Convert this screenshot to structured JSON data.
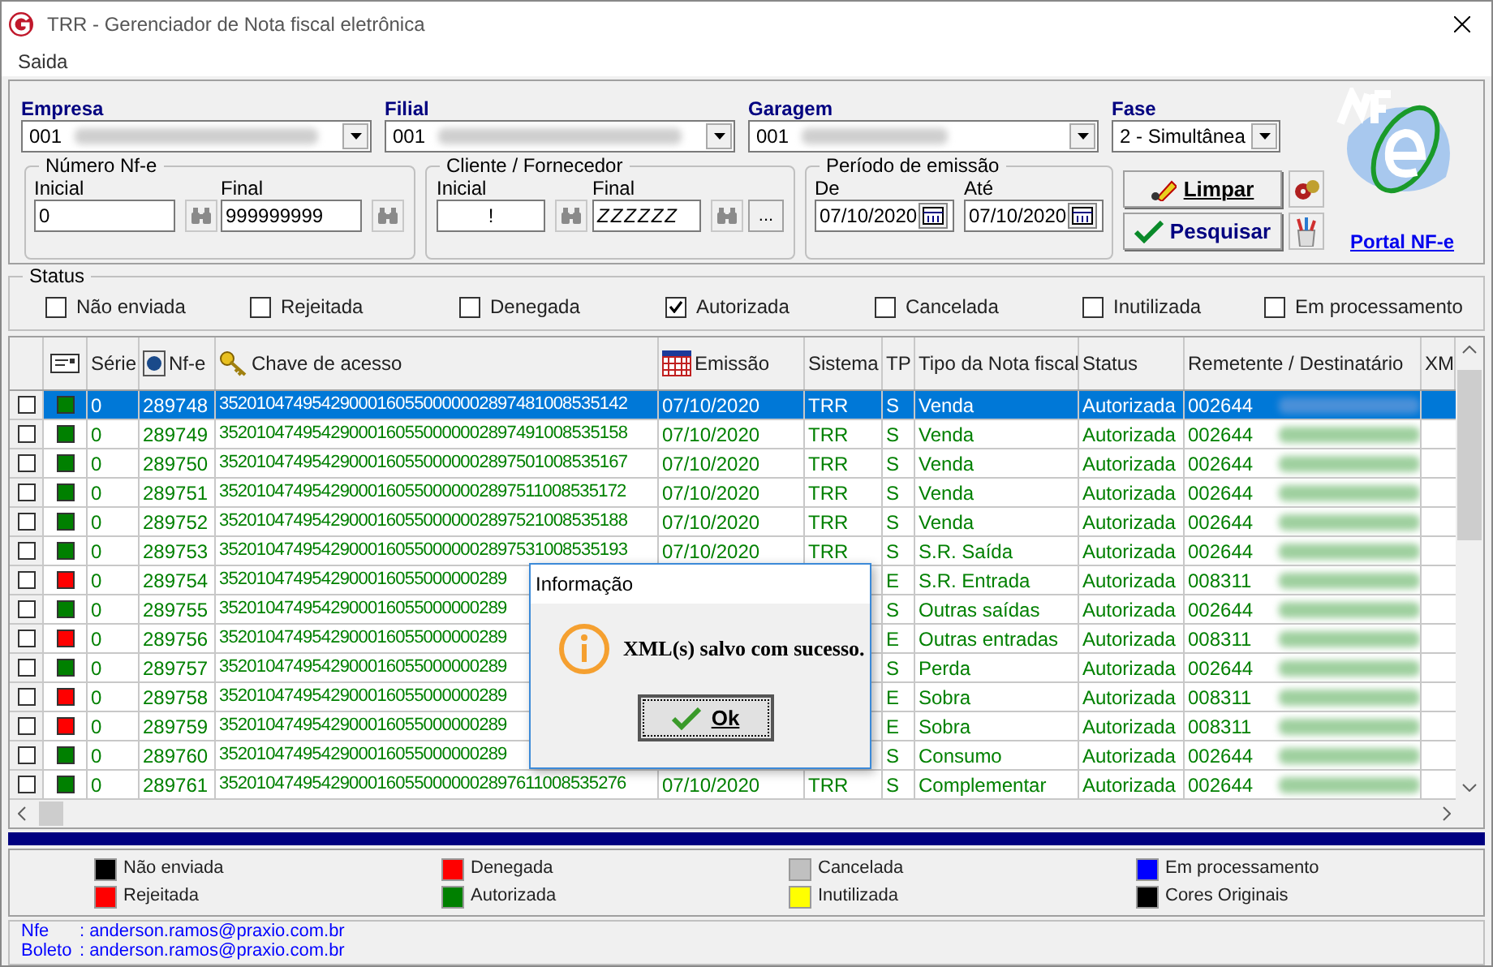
{
  "window": {
    "title": "TRR - Gerenciador de Nota fiscal eletrônica"
  },
  "menu": [
    "Saida"
  ],
  "filters": {
    "empresa": {
      "label": "Empresa",
      "value": "001"
    },
    "filial": {
      "label": "Filial",
      "value": "001"
    },
    "garagem": {
      "label": "Garagem",
      "value": "001"
    },
    "fase": {
      "label": "Fase",
      "value": "2 - Simultânea"
    }
  },
  "numero_nfe": {
    "title": "Número Nf-e",
    "inicial_label": "Inicial",
    "inicial": "0",
    "final_label": "Final",
    "final": "999999999"
  },
  "cliente_fornecedor": {
    "title": "Cliente / Fornecedor",
    "inicial_label": "Inicial",
    "inicial": "!",
    "final_label": "Final",
    "final": "ZZZZZZ",
    "more": "..."
  },
  "periodo": {
    "title": "Período de emissão",
    "de_label": "De",
    "de": "07/10/2020",
    "ate_label": "Até",
    "ate": "07/10/2020"
  },
  "buttons": {
    "limpar": "Limpar",
    "pesquisar": "Pesquisar"
  },
  "portal_link": "Portal NF-e",
  "status_filters": {
    "title": "Status",
    "items": [
      {
        "label": "Não enviada",
        "checked": false
      },
      {
        "label": "Rejeitada",
        "checked": false
      },
      {
        "label": "Denegada",
        "checked": false
      },
      {
        "label": "Autorizada",
        "checked": true
      },
      {
        "label": "Cancelada",
        "checked": false
      },
      {
        "label": "Inutilizada",
        "checked": false
      },
      {
        "label": "Em processamento",
        "checked": false
      }
    ]
  },
  "table": {
    "columns": [
      "",
      "Série",
      "Nf-e",
      "Chave de acesso",
      "Emissão",
      "Sistema",
      "TP",
      "Tipo da Nota fiscal",
      "Status",
      "Remetente / Destinatário",
      "XM"
    ],
    "rows": [
      {
        "selected": true,
        "checked": false,
        "color": "#008000",
        "serie": "0",
        "nfe": "289748",
        "chave": "35201047495429000160550000002897481008535142",
        "emissao": "07/10/2020",
        "sistema": "TRR",
        "tp": "S",
        "tipo": "Venda",
        "status": "Autorizada",
        "remetente": "002644"
      },
      {
        "selected": false,
        "checked": false,
        "color": "#008000",
        "serie": "0",
        "nfe": "289749",
        "chave": "35201047495429000160550000002897491008535158",
        "emissao": "07/10/2020",
        "sistema": "TRR",
        "tp": "S",
        "tipo": "Venda",
        "status": "Autorizada",
        "remetente": "002644"
      },
      {
        "selected": false,
        "checked": false,
        "color": "#008000",
        "serie": "0",
        "nfe": "289750",
        "chave": "35201047495429000160550000002897501008535167",
        "emissao": "07/10/2020",
        "sistema": "TRR",
        "tp": "S",
        "tipo": "Venda",
        "status": "Autorizada",
        "remetente": "002644"
      },
      {
        "selected": false,
        "checked": false,
        "color": "#008000",
        "serie": "0",
        "nfe": "289751",
        "chave": "35201047495429000160550000002897511008535172",
        "emissao": "07/10/2020",
        "sistema": "TRR",
        "tp": "S",
        "tipo": "Venda",
        "status": "Autorizada",
        "remetente": "002644"
      },
      {
        "selected": false,
        "checked": false,
        "color": "#008000",
        "serie": "0",
        "nfe": "289752",
        "chave": "35201047495429000160550000002897521008535188",
        "emissao": "07/10/2020",
        "sistema": "TRR",
        "tp": "S",
        "tipo": "Venda",
        "status": "Autorizada",
        "remetente": "002644"
      },
      {
        "selected": false,
        "checked": false,
        "color": "#008000",
        "serie": "0",
        "nfe": "289753",
        "chave": "35201047495429000160550000002897531008535193",
        "emissao": "07/10/2020",
        "sistema": "TRR",
        "tp": "S",
        "tipo": "S.R. Saída",
        "status": "Autorizada",
        "remetente": "002644"
      },
      {
        "selected": false,
        "checked": false,
        "color": "#ff0000",
        "serie": "0",
        "nfe": "289754",
        "chave": "3520104749542900016055000000289",
        "tp": "E",
        "tipo": "S.R. Entrada",
        "status": "Autorizada",
        "remetente": "008311"
      },
      {
        "selected": false,
        "checked": false,
        "color": "#008000",
        "serie": "0",
        "nfe": "289755",
        "chave": "3520104749542900016055000000289",
        "tp": "S",
        "tipo": "Outras saídas",
        "status": "Autorizada",
        "remetente": "002644"
      },
      {
        "selected": false,
        "checked": false,
        "color": "#ff0000",
        "serie": "0",
        "nfe": "289756",
        "chave": "3520104749542900016055000000289",
        "tp": "E",
        "tipo": "Outras entradas",
        "status": "Autorizada",
        "remetente": "008311"
      },
      {
        "selected": false,
        "checked": false,
        "color": "#008000",
        "serie": "0",
        "nfe": "289757",
        "chave": "3520104749542900016055000000289",
        "tp": "S",
        "tipo": "Perda",
        "status": "Autorizada",
        "remetente": "002644"
      },
      {
        "selected": false,
        "checked": false,
        "color": "#ff0000",
        "serie": "0",
        "nfe": "289758",
        "chave": "3520104749542900016055000000289",
        "tp": "E",
        "tipo": "Sobra",
        "status": "Autorizada",
        "remetente": "008311"
      },
      {
        "selected": false,
        "checked": false,
        "color": "#ff0000",
        "serie": "0",
        "nfe": "289759",
        "chave": "3520104749542900016055000000289",
        "tp": "E",
        "tipo": "Sobra",
        "status": "Autorizada",
        "remetente": "008311"
      },
      {
        "selected": false,
        "checked": false,
        "color": "#008000",
        "serie": "0",
        "nfe": "289760",
        "chave": "3520104749542900016055000000289",
        "tp": "S",
        "tipo": "Consumo",
        "status": "Autorizada",
        "remetente": "002644"
      },
      {
        "selected": false,
        "checked": false,
        "color": "#008000",
        "serie": "0",
        "nfe": "289761",
        "chave": "35201047495429000160550000002897611008535276",
        "emissao": "07/10/2020",
        "sistema": "TRR",
        "tp": "S",
        "tipo": "Complementar",
        "status": "Autorizada",
        "remetente": "002644"
      }
    ]
  },
  "dialog": {
    "title": "Informação",
    "message": "XML(s) salvo com sucesso.",
    "button": "Ok"
  },
  "legend": [
    {
      "label": "Não enviada",
      "color": "#000000"
    },
    {
      "label": "Denegada",
      "color": "#ff0000"
    },
    {
      "label": "Cancelada",
      "color": "#c0c0c0"
    },
    {
      "label": "Em processamento",
      "color": "#0000ff"
    },
    {
      "label": "Rejeitada",
      "color": "#ff0000"
    },
    {
      "label": "Autorizada",
      "color": "#008000"
    },
    {
      "label": "Inutilizada",
      "color": "#ffff00"
    },
    {
      "label": "Cores Originais",
      "color": "#000000"
    }
  ],
  "footer": [
    {
      "label": "Nfe",
      "separator": ":",
      "value": "anderson.ramos@praxio.com.br"
    },
    {
      "label": "Boleto",
      "separator": ":",
      "value": "anderson.ramos@praxio.com.br"
    }
  ]
}
